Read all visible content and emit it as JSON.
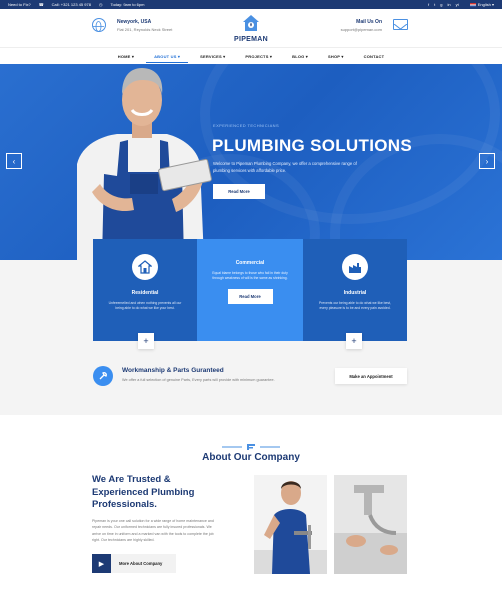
{
  "topbar": {
    "need_fix": "Need to Fix?",
    "call": "Call: +321 123 45 978",
    "hours": "Today: 9am to 6pm",
    "socials": [
      "f",
      "t",
      "g",
      "in",
      "yt"
    ],
    "language": "English"
  },
  "header": {
    "location_title": "Newyork, USA",
    "location_sub": "Flat 201, Reynolds Neck Street",
    "logo_text": "PIPEMAN",
    "mail_title": "Mail Us On",
    "mail_sub": "support@pipeman.com"
  },
  "nav": {
    "items": [
      "HOME",
      "ABOUT US",
      "SERVICES",
      "PROJECTS",
      "BLOG",
      "SHOP",
      "CONTACT"
    ]
  },
  "hero": {
    "eyebrow": "EXPERIENCED TECHNICIANS",
    "title": "PLUMBING SOLUTIONS",
    "desc_line1": "Welcome to Pipeman Plumbing Company, we offer a comprehensive range of",
    "desc_line2": "plumbing services with affordable price.",
    "button": "Read More",
    "prev": "‹",
    "next": "›"
  },
  "services": [
    {
      "title": "Residential",
      "desc": "Unfeeemelied and when nothing prevents all our being able to do what we like your best."
    },
    {
      "title": "Commercial",
      "desc": "Equal blame belongs to those who fail in their duty through weakness of will is the same as shrinking.",
      "button": "Read More"
    },
    {
      "title": "Industrial",
      "desc": "Prevents our being able to do what we like best, every pleasure is to be and every pain avoided."
    }
  ],
  "guarantee": {
    "title": "Workmanship & Parts Guranteed",
    "desc": "We offer a full selection of genuine Parts, Every parts will provide with minimum guarantee.",
    "button": "Make an Appointment"
  },
  "about": {
    "heading": "About Our Company",
    "title_line1": "We Are Trusted &",
    "title_line2": "Experienced Plumbing",
    "title_line3": "Professionals.",
    "p_line1": "Pipeman is your one call solution for a wide range of home maintenance and",
    "p_line2": "repair needs. Our uniformed technicians are fully insured professionals. We",
    "p_line3": "arrive on time in uniform and a marked van with the tools to complete the job",
    "p_line4": "right. Our technicians are highly skilled.",
    "button": "More About Company"
  },
  "colors": {
    "navy": "#1d3a74",
    "primary_blue": "#2a6fd0",
    "light_blue": "#3a8ef0",
    "accent": "#4a90e2"
  }
}
